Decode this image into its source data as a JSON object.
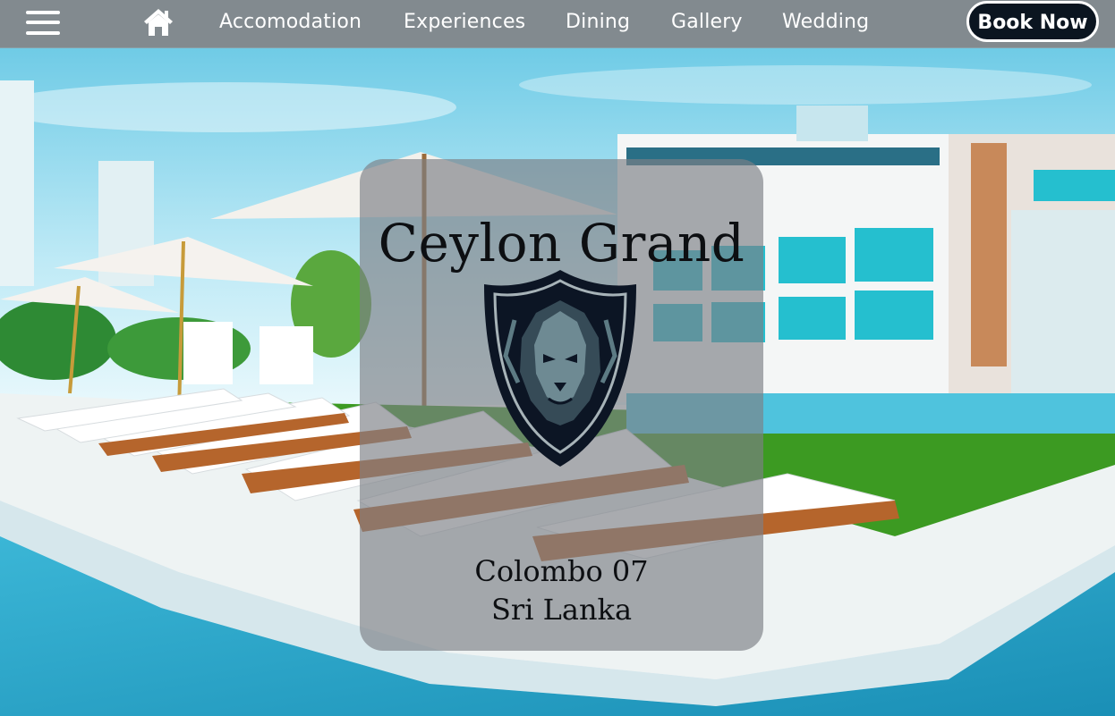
{
  "nav": {
    "links": [
      "Accomodation",
      "Experiences",
      "Dining",
      "Gallery",
      "Wedding"
    ],
    "book_label": "Book Now"
  },
  "hero": {
    "title": "Ceylon Grand",
    "location_line1": "Colombo 07",
    "location_line2": "Sri Lanka"
  },
  "icons": {
    "menu": "menu-icon",
    "home": "home-icon",
    "crest": "lion-crest-logo"
  },
  "colors": {
    "nav_bg": "#5f6970",
    "button_bg": "#0b1520",
    "sky": "#7fd2ea",
    "pool": "#1f9cc0",
    "lawn": "#3c9a22"
  }
}
